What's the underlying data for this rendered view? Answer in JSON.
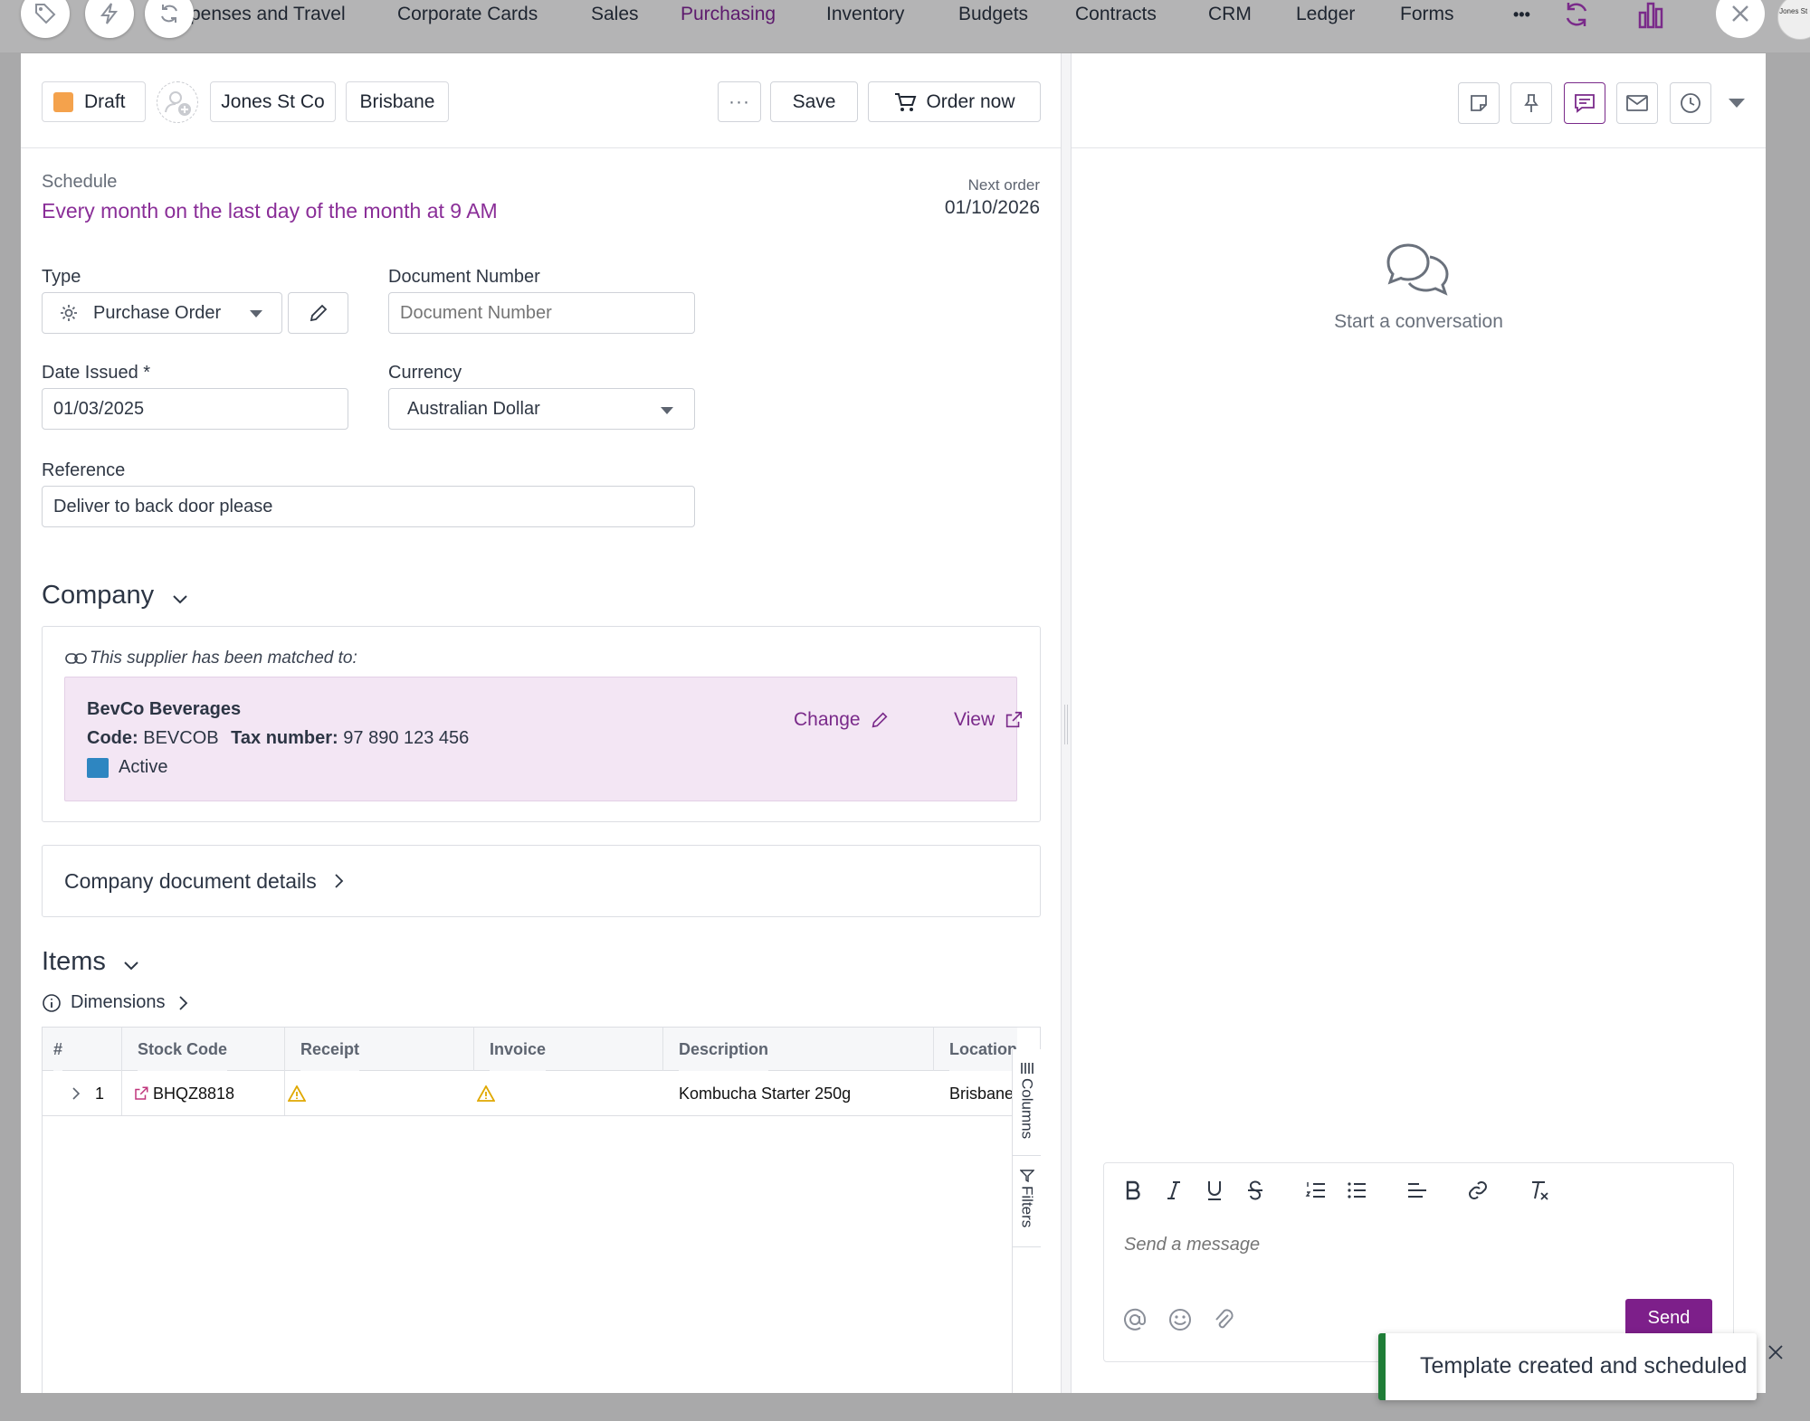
{
  "nav": {
    "items": [
      {
        "key": "expenses",
        "label": "penses and Travel"
      },
      {
        "key": "corporate-cards",
        "label": "Corporate Cards"
      },
      {
        "key": "sales",
        "label": "Sales"
      },
      {
        "key": "purchasing",
        "label": "Purchasing",
        "active": true
      },
      {
        "key": "inventory",
        "label": "Inventory"
      },
      {
        "key": "budgets",
        "label": "Budgets"
      },
      {
        "key": "contracts",
        "label": "Contracts"
      },
      {
        "key": "crm",
        "label": "CRM"
      },
      {
        "key": "ledger",
        "label": "Ledger"
      },
      {
        "key": "forms",
        "label": "Forms"
      }
    ],
    "more_label": "•••",
    "avatar_text": "Jones St Co.",
    "float_icons": [
      "tag-icon",
      "lightning-icon",
      "refresh-icon"
    ]
  },
  "header": {
    "status_label": "Draft",
    "status_color": "#f4a24c",
    "company_chip": "Jones St Co",
    "location_chip": "Brisbane",
    "more_label": "···",
    "save_label": "Save",
    "order_label": "Order now"
  },
  "schedule": {
    "label": "Schedule",
    "text": "Every month on the last day of the month at 9 AM",
    "next_order_label": "Next order",
    "next_order_date": "01/10/2026"
  },
  "form": {
    "type_label": "Type",
    "type_value": "Purchase Order",
    "doc_number_label": "Document Number",
    "doc_number_placeholder": "Document Number",
    "date_label": "Date Issued *",
    "date_value": "01/03/2025",
    "currency_label": "Currency",
    "currency_value": "Australian Dollar",
    "reference_label": "Reference",
    "reference_value": "Deliver to back door please"
  },
  "company": {
    "title": "Company",
    "matched_text": "This supplier has been matched to:",
    "name": "BevCo Beverages",
    "code_label": "Code:",
    "code_value": "BEVCOB",
    "tax_label": "Tax number:",
    "tax_value": "97 890 123 456",
    "status_label": "Active",
    "status_color": "#2e86c1",
    "change_label": "Change",
    "view_label": "View",
    "doc_details_label": "Company document details"
  },
  "items": {
    "title": "Items",
    "dimensions_label": "Dimensions",
    "columns": [
      "#",
      "Stock Code",
      "Receipt",
      "Invoice",
      "Description",
      "Location"
    ],
    "rows": [
      {
        "num": "1",
        "stock_code": "BHQZ8818",
        "description": "Kombucha Starter 250g",
        "location": "Brisbane"
      }
    ],
    "columns_tab": "Columns",
    "filters_tab": "Filters"
  },
  "conversation": {
    "empty_text": "Start a conversation",
    "message_placeholder": "Send a message",
    "send_label": "Send"
  },
  "toast": {
    "text": "Template created and scheduled",
    "accent": "#1f7d37"
  },
  "colors": {
    "accent": "#7d1f8a",
    "nav_active": "#5d1a6d"
  }
}
